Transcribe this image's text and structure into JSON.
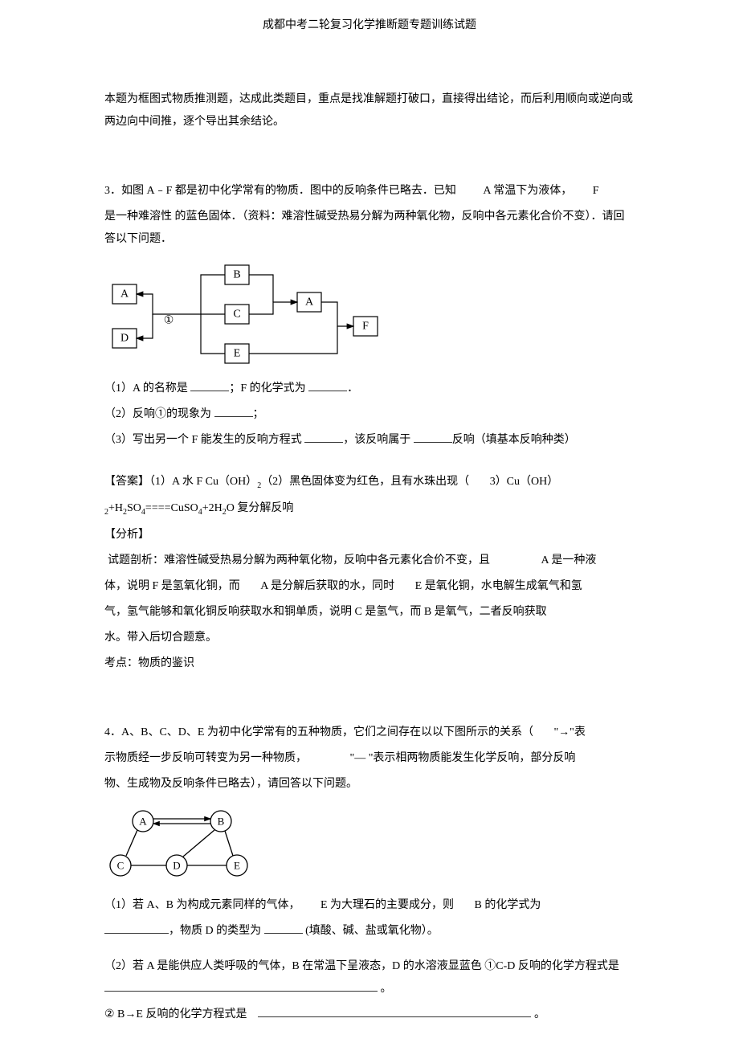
{
  "header": {
    "title": "成都中考二轮复习化学推断题专题训练试题"
  },
  "intro": {
    "p1": "本题为框图式物质推测题，达成此类题目，重点是找准解题打破口，直接得出结论，而后利用顺向或逆向或两边向中间推，逐个导出其余结论。"
  },
  "q3": {
    "num": "3．",
    "stem_a": "如图 A﹣F 都是初中化学常有的物质．图中的反响条件已略去．已知",
    "stem_b": "A 常温下为液体，",
    "stem_c": "F",
    "stem_d": "是一种难溶性 的蓝色固体．（资料：难溶性碱受热易分解为两种氧化物，反响中各元素化合价不变）．请回答以下问题．",
    "diagram_labels": {
      "A": "A",
      "B": "B",
      "C": "C",
      "D": "D",
      "E": "E",
      "F": "F",
      "A2": "A",
      "circ1": "①"
    },
    "sub1_a": "（1）A 的名称是 ",
    "sub1_b": "；F 的化学式为 ",
    "sub1_c": "．",
    "sub2_a": "（2）反响①的现象为 ",
    "sub2_b": "；",
    "sub3_a": "（3）写出另一个 F 能发生的反响方程式 ",
    "sub3_b": "，该反响属于 ",
    "sub3_c": "反响（填基本反响种类）",
    "ans_label": "【答案】",
    "ans_a": "（1）A 水 F Cu（OH）",
    "ans_b": "（2）黑色固体变为红色，且有水珠出现（",
    "ans_c": "3）Cu（OH）",
    "ans_d": "+H",
    "ans_e": "SO",
    "ans_f": "====CuSO",
    "ans_g": "+2H",
    "ans_h": "O 复分解反响",
    "ans_2a": "2",
    "ans_2b": "2",
    "ans_2c": "4",
    "ans_2d": "4",
    "ans_2e": "2",
    "analysis_label": "【分析】",
    "analysis_p1a": "试题剖析：难溶性碱受热易分解为两种氧化物，反响中各元素化合价不变，且",
    "analysis_p1b": "A 是一种液",
    "analysis_p2a": "体，说明 F 是氢氧化铜，而",
    "analysis_p2b": "A 是分解后获取的水，同时",
    "analysis_p2c": "E 是氧化铜，水电解生成氧气和氢",
    "analysis_p3": "气，氢气能够和氧化铜反响获取水和铜单质，说明 C 是氢气，而 B 是氧气，二者反响获取",
    "analysis_p4": "水。带入后切合题意。",
    "analysis_p5": "考点：物质的鉴识"
  },
  "q4": {
    "num": "4．",
    "stem_a": "A、B、C、D、E 为初中化学常有的五种物质，它们之间存在以以下图所示的关系（",
    "stem_b": "\"→\"表",
    "stem_c": "示物质经一步反响可转变为另一种物质，",
    "stem_d": "\"— \"表示相两物质能发生化学反响，部分反响",
    "stem_e": "物、生成物及反响条件已略去），请回答以下问题。",
    "diagram_labels": {
      "A": "A",
      "B": "B",
      "C": "C",
      "D": "D",
      "E": "E"
    },
    "sub1_a": "（1）若 A、B 为构成元素同样的气体，",
    "sub1_b": "E 为大理石的主要成分，则",
    "sub1_c": "B 的化学式为",
    "sub1_d": "，物质 D 的类型为 ",
    "sub1_e": "(填酸、碱、盐或氧化物）。",
    "sub2_a": "（2）若 A 是能供应人类呼吸的气体，B 在常温下呈液态，D 的水溶液显蓝色 ①C-D 反响的化学方程式是 ",
    "sub2_b": "。",
    "sub3_a": "② B→E 反响的化学方程式是",
    "sub3_b": "。"
  }
}
